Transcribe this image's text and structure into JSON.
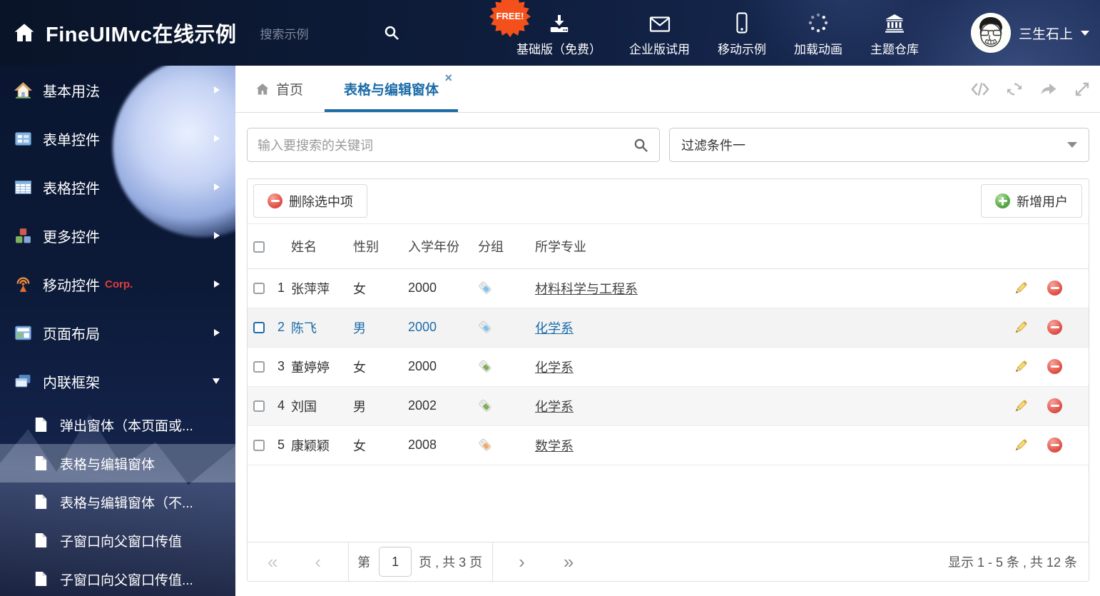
{
  "header": {
    "title": "FineUIMvc在线示例",
    "search_placeholder": "搜索示例",
    "free_badge": "FREE!",
    "nav": [
      {
        "label": "基础版（免费）",
        "icon": "download"
      },
      {
        "label": "企业版试用",
        "icon": "envelope"
      },
      {
        "label": "移动示例",
        "icon": "mobile"
      },
      {
        "label": "加载动画",
        "icon": "spinner"
      },
      {
        "label": "主题仓库",
        "icon": "bank"
      }
    ],
    "user": {
      "name": "三生石上"
    }
  },
  "sidebar": {
    "items": [
      {
        "label": "基本用法",
        "icon": "home",
        "expanded": false
      },
      {
        "label": "表单控件",
        "icon": "form",
        "expanded": false
      },
      {
        "label": "表格控件",
        "icon": "grid",
        "expanded": false
      },
      {
        "label": "更多控件",
        "icon": "cubes",
        "expanded": false
      },
      {
        "label": "移动控件",
        "icon": "antenna",
        "badge": "Corp.",
        "expanded": false
      },
      {
        "label": "页面布局",
        "icon": "layout",
        "expanded": false
      },
      {
        "label": "内联框架",
        "icon": "frames",
        "expanded": true
      }
    ],
    "subitems": [
      {
        "label": "弹出窗体（本页面或...",
        "selected": false
      },
      {
        "label": "表格与编辑窗体",
        "selected": true
      },
      {
        "label": "表格与编辑窗体（不...",
        "selected": false
      },
      {
        "label": "子窗口向父窗口传值",
        "selected": false
      },
      {
        "label": "子窗口向父窗口传值...",
        "selected": false
      }
    ]
  },
  "tabs": {
    "home": "首页",
    "active": "表格与编辑窗体",
    "close_icon": "×"
  },
  "filters": {
    "search_placeholder": "输入要搜索的关键词",
    "filter_value": "过滤条件一"
  },
  "toolbar": {
    "delete_label": "删除选中项",
    "add_label": "新增用户"
  },
  "table": {
    "columns": [
      "姓名",
      "性别",
      "入学年份",
      "分组",
      "所学专业"
    ],
    "rows": [
      {
        "index": "1",
        "name": "张萍萍",
        "gender": "女",
        "year": "2000",
        "tag": "blue",
        "major": "材料科学与工程系",
        "selected": false
      },
      {
        "index": "2",
        "name": "陈飞",
        "gender": "男",
        "year": "2000",
        "tag": "blue",
        "major": "化学系",
        "selected": true
      },
      {
        "index": "3",
        "name": "董婷婷",
        "gender": "女",
        "year": "2000",
        "tag": "green",
        "major": "化学系",
        "selected": false
      },
      {
        "index": "4",
        "name": "刘国",
        "gender": "男",
        "year": "2002",
        "tag": "green",
        "major": "化学系",
        "selected": false
      },
      {
        "index": "5",
        "name": "康颖颖",
        "gender": "女",
        "year": "2008",
        "tag": "orange",
        "major": "数学系",
        "selected": false
      }
    ]
  },
  "pagination": {
    "page_prefix": "第",
    "current_page": "1",
    "page_suffix": "页 , 共 3 页",
    "summary": "显示 1 - 5 条 , 共 12 条",
    "icons": {
      "first": "«",
      "prev": "‹",
      "next": "›",
      "last": "»"
    }
  },
  "colors": {
    "accent": "#1b6ca8",
    "header_bg": "#0d1a33",
    "corp_red": "#e23c3c",
    "free_badge_orange": "#f4501c",
    "delete_red": "#e2544a",
    "add_green": "#57a847",
    "tags": {
      "blue": "#7dc2f0",
      "green": "#7fae57",
      "orange": "#f5a963"
    }
  }
}
